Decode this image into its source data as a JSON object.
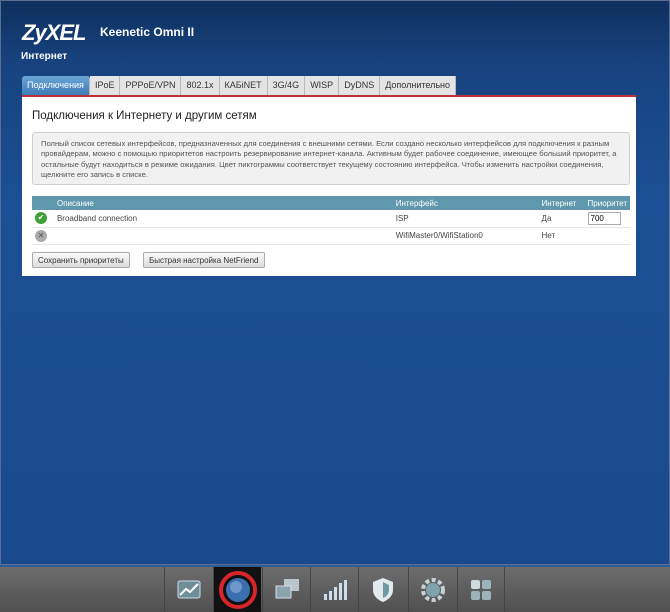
{
  "header": {
    "logo": "ZyXEL",
    "model": "Keenetic Omni II",
    "section": "Интернет"
  },
  "tabs": [
    "Подключения",
    "IPoE",
    "PPPoE/VPN",
    "802.1x",
    "КАБiNET",
    "3G/4G",
    "WISP",
    "DyDNS",
    "Дополнительно"
  ],
  "panel": {
    "title": "Подключения к Интернету и другим сетям",
    "info": "Полный список сетевых интерфейсов, предназначенных для соединения с внешними сетями. Если создано несколько интерфейсов для подключения к разным провайдерам, можно с помощью приоритетов настроить резервирование интернет-канала. Активным будет рабочее соединение, имеющее больший приоритет, а остальные будут находиться в режиме ожидания. Цвет пиктограммы соответствует текущему состоянию интерфейса. Чтобы изменить настройки соединения, щелкните его запись в списке.",
    "columns": [
      "Описание",
      "Интерфейс",
      "Интернет",
      "Приоритет"
    ],
    "rows": [
      {
        "status": "check-icon",
        "description": "Broadband connection",
        "interface": "ISP",
        "internet": "Да",
        "priority": "700"
      },
      {
        "status": "cross-icon",
        "description": "",
        "interface": "WifiMaster0/WifiStation0",
        "internet": "Нет",
        "priority": ""
      }
    ],
    "save_button": "Сохранить приоритеты",
    "netfriend_button": "Быстрая настройка NetFriend"
  },
  "taskbar": [
    "monitor-icon",
    "internet-globe-icon",
    "home-network-icon",
    "wifi-signal-icon",
    "security-shield-icon",
    "system-gear-icon",
    "apps-grid-icon"
  ]
}
